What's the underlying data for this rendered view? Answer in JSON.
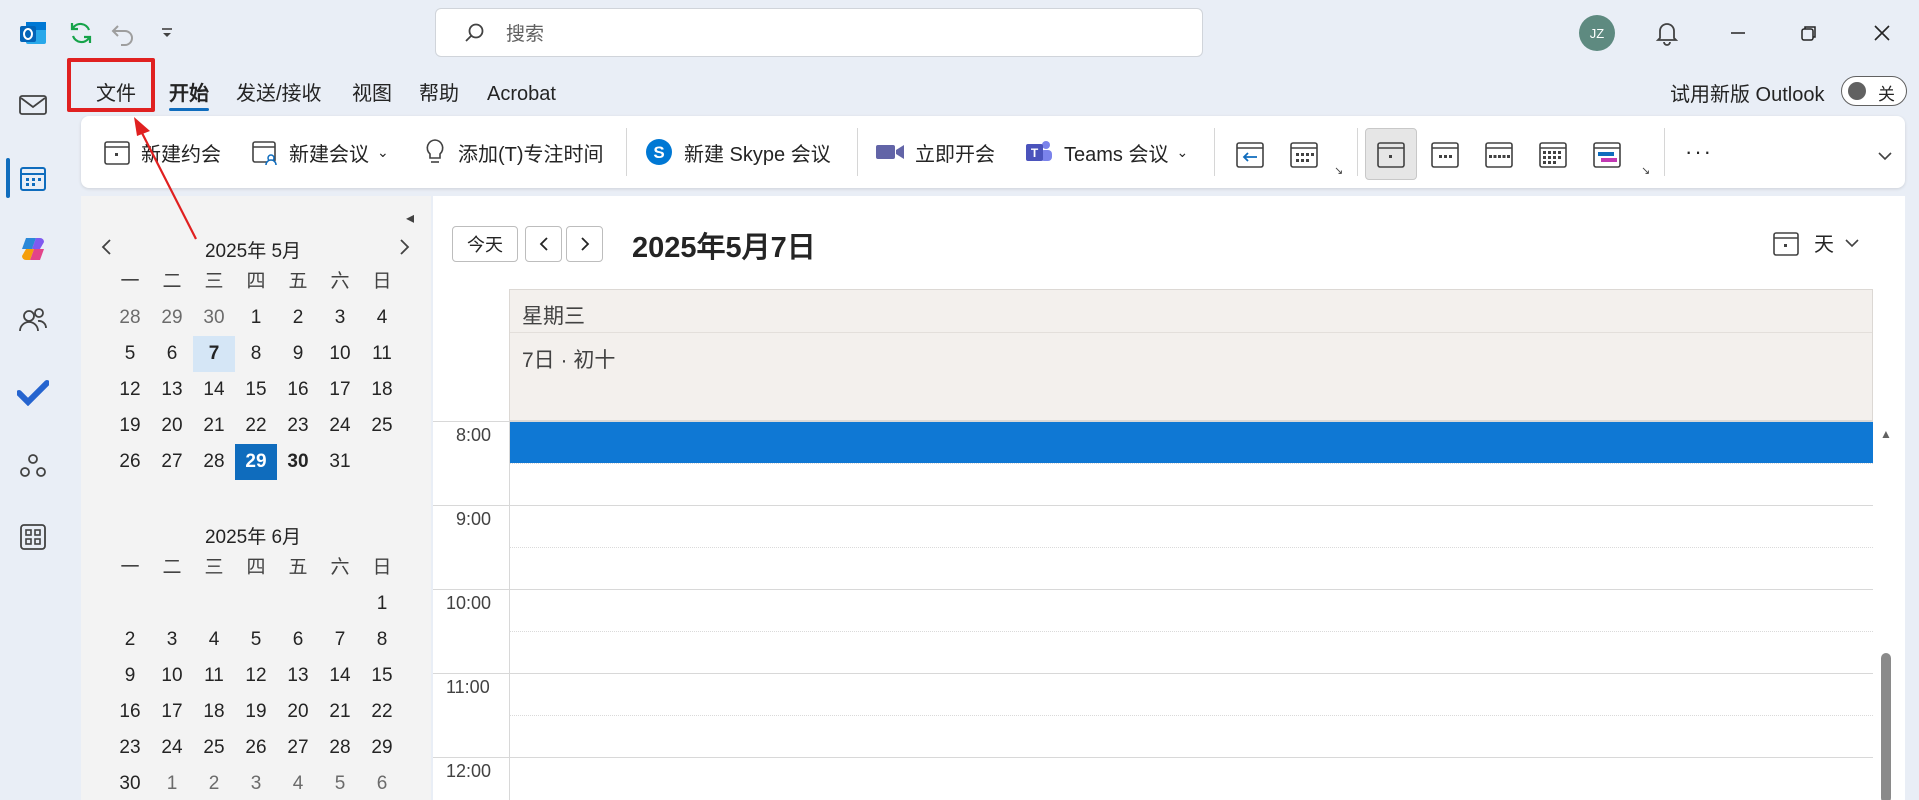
{
  "titlebar": {
    "search_placeholder": "搜索",
    "avatar_initials": "JZ"
  },
  "menu": {
    "tabs": [
      "文件",
      "开始",
      "发送/接收",
      "视图",
      "帮助",
      "Acrobat"
    ],
    "active_tab": "开始",
    "highlighted_tab": "文件"
  },
  "try_new": {
    "label": "试用新版 Outlook",
    "toggle_state": "关"
  },
  "ribbon": {
    "new_appointment": "新建约会",
    "new_meeting": "新建会议",
    "add_focus_time": "添加(T)专注时间",
    "new_skype_meeting": "新建 Skype 会议",
    "meet_now": "立即开会",
    "teams_meeting": "Teams 会议",
    "more": "···"
  },
  "mini_calendar_may": {
    "title": "2025年 5月",
    "weekdays": [
      "一",
      "二",
      "三",
      "四",
      "五",
      "六",
      "日"
    ],
    "weeks": [
      [
        "28",
        "29",
        "30",
        "1",
        "2",
        "3",
        "4"
      ],
      [
        "5",
        "6",
        "7",
        "8",
        "9",
        "10",
        "11"
      ],
      [
        "12",
        "13",
        "14",
        "15",
        "16",
        "17",
        "18"
      ],
      [
        "19",
        "20",
        "21",
        "22",
        "23",
        "24",
        "25"
      ],
      [
        "26",
        "27",
        "28",
        "29",
        "30",
        "31",
        ""
      ]
    ],
    "selected_day": "7",
    "today": "29",
    "bold_days": [
      "30"
    ]
  },
  "mini_calendar_june": {
    "title": "2025年 6月",
    "weekdays": [
      "一",
      "二",
      "三",
      "四",
      "五",
      "六",
      "日"
    ],
    "weeks": [
      [
        "",
        "",
        "",
        "",
        "",
        "",
        "1"
      ],
      [
        "2",
        "3",
        "4",
        "5",
        "6",
        "7",
        "8"
      ],
      [
        "9",
        "10",
        "11",
        "12",
        "13",
        "14",
        "15"
      ],
      [
        "16",
        "17",
        "18",
        "19",
        "20",
        "21",
        "22"
      ],
      [
        "23",
        "24",
        "25",
        "26",
        "27",
        "28",
        "29"
      ],
      [
        "30",
        "1",
        "2",
        "3",
        "4",
        "5",
        "6"
      ]
    ]
  },
  "main": {
    "today_button": "今天",
    "date_heading": "2025年5月7日",
    "view_label": "天",
    "weekday": "星期三",
    "day_subtitle": "7日 · 初十",
    "hours": [
      "8:00",
      "9:00",
      "10:00",
      "11:00",
      "12:00"
    ]
  },
  "colors": {
    "accent": "#0f6cbd",
    "event": "#0f78d4",
    "annotation": "#e02020"
  }
}
